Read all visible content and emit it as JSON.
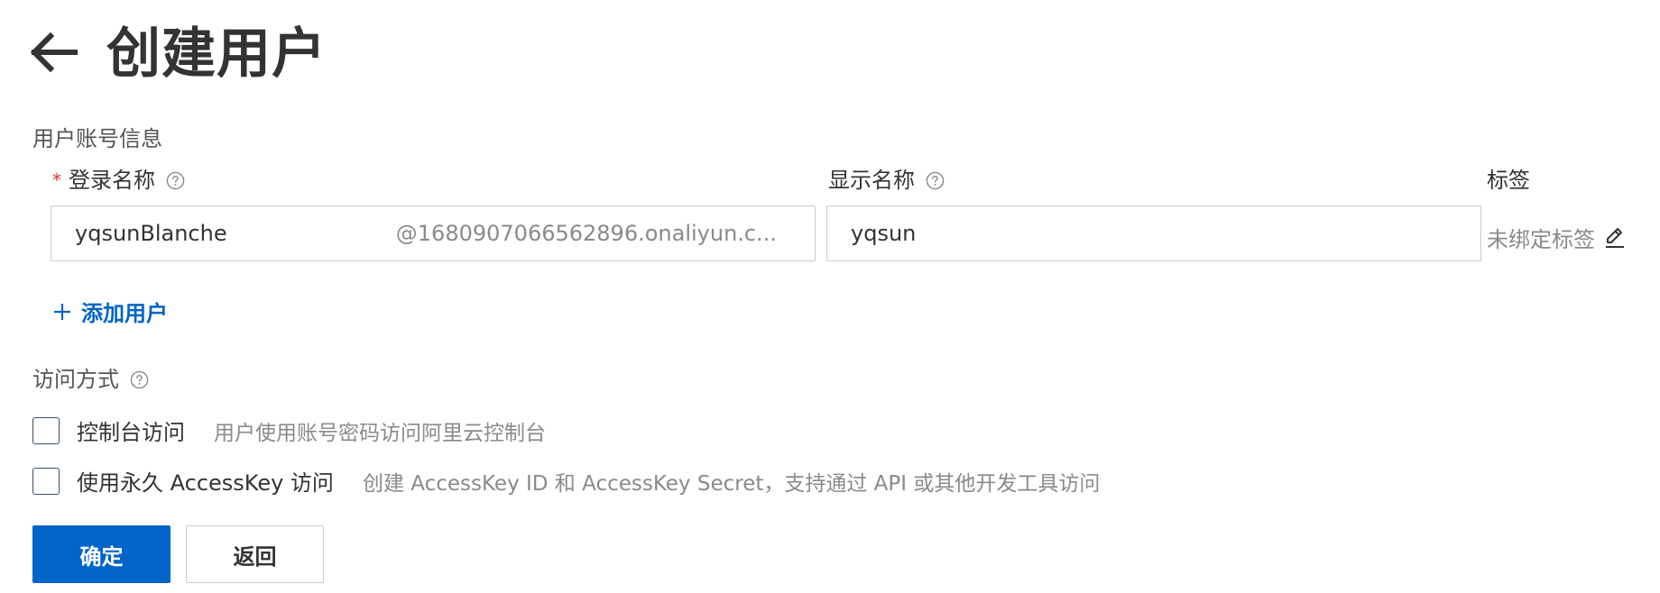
{
  "header": {
    "title": "创建用户",
    "back_icon": "arrow-left-icon"
  },
  "account_section": {
    "title": "用户账号信息",
    "login_name": {
      "required_mark": "*",
      "label": "登录名称",
      "value": "yqsunBlanche",
      "suffix": "@1680907066562896.onaliyun.c..."
    },
    "display_name": {
      "label": "显示名称",
      "value": "yqsun"
    },
    "tags": {
      "label": "标签",
      "value": "未绑定标签",
      "edit_icon": "pencil-icon"
    },
    "add_user_label": "添加用户"
  },
  "access_section": {
    "title": "访问方式",
    "options": [
      {
        "label": "控制台访问",
        "description": "用户使用账号密码访问阿里云控制台",
        "checked": false
      },
      {
        "label": "使用永久 AccessKey 访问",
        "description": "创建 AccessKey ID 和 AccessKey Secret，支持通过 API 或其他开发工具访问",
        "checked": false
      }
    ]
  },
  "actions": {
    "confirm_label": "确定",
    "back_label": "返回"
  },
  "colors": {
    "primary": "#0064c8",
    "required": "#e0302a",
    "muted_text": "#8a8a8a",
    "border": "#c6cbd4"
  }
}
